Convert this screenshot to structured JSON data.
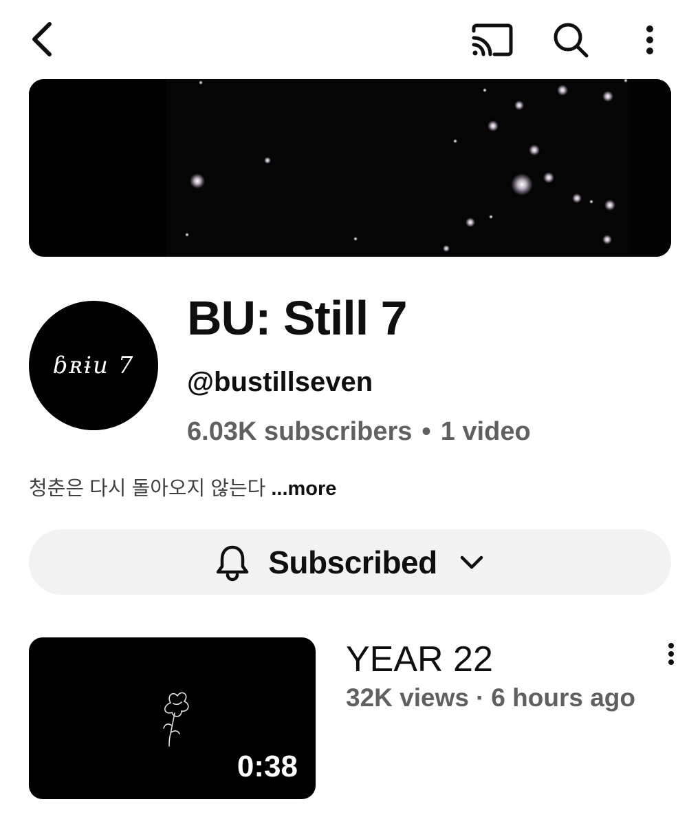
{
  "header": {
    "back_icon": "chevron-left-icon",
    "cast_icon": "cast-icon",
    "search_icon": "search-icon",
    "more_icon": "more-vertical-icon"
  },
  "channel": {
    "avatar_text": "ɓʀɨu 7",
    "name": "BU: Still 7",
    "handle": "@bustillseven",
    "subscribers": "6.03K subscribers",
    "separator": "•",
    "videos": "1 video",
    "description": "청춘은 다시 돌아오지 않는다",
    "more_label": "...more"
  },
  "subscribe": {
    "label": "Subscribed",
    "bell_icon": "bell-icon",
    "chevron_icon": "chevron-down-icon"
  },
  "videos": [
    {
      "title": "YEAR 22",
      "views": "32K views",
      "separator": "·",
      "age": "6 hours ago",
      "duration": "0:38"
    }
  ],
  "colors": {
    "text_primary": "#0f0f0f",
    "text_secondary": "#606060",
    "button_bg": "#f2f2f2",
    "banner_bg": "#000000"
  }
}
